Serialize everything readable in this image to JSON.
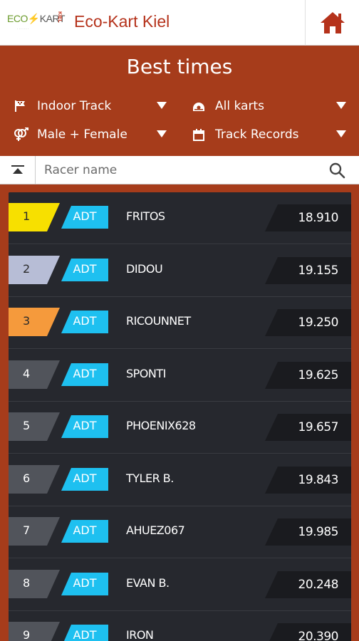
{
  "app": {
    "title": "Eco-Kart Kiel",
    "logo": {
      "eco": "ECO",
      "bolt": "⚡",
      "kart": "KART",
      "kiel": "KIEL",
      "sub": "· · · · · · ·"
    }
  },
  "header": {
    "title": "Best times",
    "filters": {
      "track": {
        "label": "Indoor Track",
        "icon": "flag-icon"
      },
      "karts": {
        "label": "All karts",
        "icon": "steering-wheel-icon"
      },
      "gender": {
        "label": "Male + Female",
        "icon": "gender-icon"
      },
      "period": {
        "label": "Track Records",
        "icon": "calendar-icon"
      }
    }
  },
  "search": {
    "placeholder": "Racer name"
  },
  "colors": {
    "brand": "#a63c1b",
    "gold": "#f7e000",
    "silver": "#b7bdd6",
    "bronze": "#f59a3c",
    "rank_default": "#51545b",
    "tag": "#1ec0f0",
    "time_bg": "#1a1b1f"
  },
  "results": [
    {
      "rank": "1",
      "tag": "ADT",
      "name": "FRITOS",
      "time": "18.910",
      "medal": "gold"
    },
    {
      "rank": "2",
      "tag": "ADT",
      "name": "DIDOU",
      "time": "19.155",
      "medal": "silver"
    },
    {
      "rank": "3",
      "tag": "ADT",
      "name": "RICOUNNET",
      "time": "19.250",
      "medal": "bronze"
    },
    {
      "rank": "4",
      "tag": "ADT",
      "name": "SPONTI",
      "time": "19.625",
      "medal": "none"
    },
    {
      "rank": "5",
      "tag": "ADT",
      "name": "PHOENIX628",
      "time": "19.657",
      "medal": "none"
    },
    {
      "rank": "6",
      "tag": "ADT",
      "name": "TYLER B.",
      "time": "19.843",
      "medal": "none"
    },
    {
      "rank": "7",
      "tag": "ADT",
      "name": "AHUEZ067",
      "time": "19.985",
      "medal": "none"
    },
    {
      "rank": "8",
      "tag": "ADT",
      "name": "EVAN B.",
      "time": "20.248",
      "medal": "none"
    },
    {
      "rank": "9",
      "tag": "ADT",
      "name": "IRON",
      "time": "20.390",
      "medal": "none"
    }
  ]
}
